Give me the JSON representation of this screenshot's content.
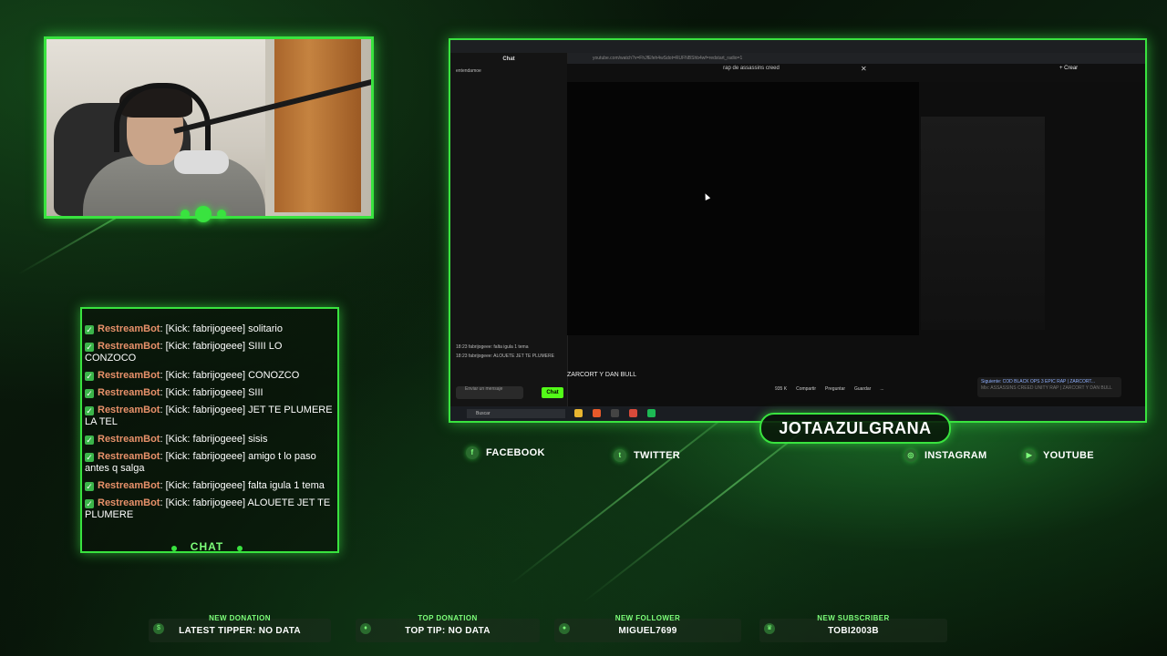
{
  "colors": {
    "accent": "#39e33f",
    "username": "#e8916a",
    "kick_green": "#53fc18"
  },
  "chat": {
    "label": "CHAT",
    "messages": [
      {
        "user": "RestreamBot",
        "text": "[Kick: fabrijogeee] solitario"
      },
      {
        "user": "RestreamBot",
        "text": "[Kick: fabrijogeee] SIIII LO CONZOCO"
      },
      {
        "user": "RestreamBot",
        "text": "[Kick: fabrijogeee] CONOZCO"
      },
      {
        "user": "RestreamBot",
        "text": "[Kick: fabrijogeee] SIII"
      },
      {
        "user": "RestreamBot",
        "text": "[Kick: fabrijogeee] JET TE PLUMERE LA TEL"
      },
      {
        "user": "RestreamBot",
        "text": "[Kick: fabrijogeee] sisis"
      },
      {
        "user": "RestreamBot",
        "text": "[Kick: fabrijogeee] amigo t lo paso antes q salga"
      },
      {
        "user": "RestreamBot",
        "text": "[Kick: fabrijogeee] falta igula 1 tema"
      },
      {
        "user": "RestreamBot",
        "text": "[Kick: fabrijogeee] ALOUETE JET TE PLUMERE"
      }
    ]
  },
  "screen": {
    "chat_title": "Chat",
    "chat_first_user": "entendamoe",
    "mini_msgs": [
      "18:23 fabrijogeee: falta igula 1 tema",
      "18:23 fabrijogeee: ALOUETE JET TE PLUMERE"
    ],
    "chat_input_placeholder": "Enviar un mensaje",
    "chat_button": "Chat",
    "url": "youtube.com/watch?v=FhJfEfeh4wSdot=RUFNBShb4wf=redstart_radio=1",
    "search_query": "rap de assassins creed",
    "create_button": "+ Crear",
    "video_title": "ZARCORT Y DAN BULL",
    "actions": [
      "935 K",
      "Compartir",
      "Preguntar",
      "Guardar",
      "..."
    ],
    "next_up": "Siguiente: COD BLACK OPS 3 EPIC RAP | ZARCORT...",
    "next_sub": "Mix: ASSASSINS CREED UNITY RAP | ZARCORT Y DAN BULL",
    "taskbar_search": "Buscar"
  },
  "channel_name": "JOTAAZULGRANA",
  "socials": [
    {
      "name": "FACEBOOK",
      "icon": "facebook-icon"
    },
    {
      "name": "TWITTER",
      "icon": "twitter-icon"
    },
    {
      "name": "INSTAGRAM",
      "icon": "instagram-icon"
    },
    {
      "name": "YOUTUBE",
      "icon": "youtube-icon"
    }
  ],
  "stats": [
    {
      "label": "NEW DONATION",
      "value": "LATEST TIPPER: NO DATA",
      "icon": "donation-icon"
    },
    {
      "label": "TOP DONATION",
      "value": "TOP TIP: NO DATA",
      "icon": "top-donation-icon"
    },
    {
      "label": "NEW FOLLOWER",
      "value": "MIGUEL7699",
      "icon": "follower-icon"
    },
    {
      "label": "NEW SUBSCRIBER",
      "value": "TOBI2003B",
      "icon": "crown-icon"
    }
  ]
}
